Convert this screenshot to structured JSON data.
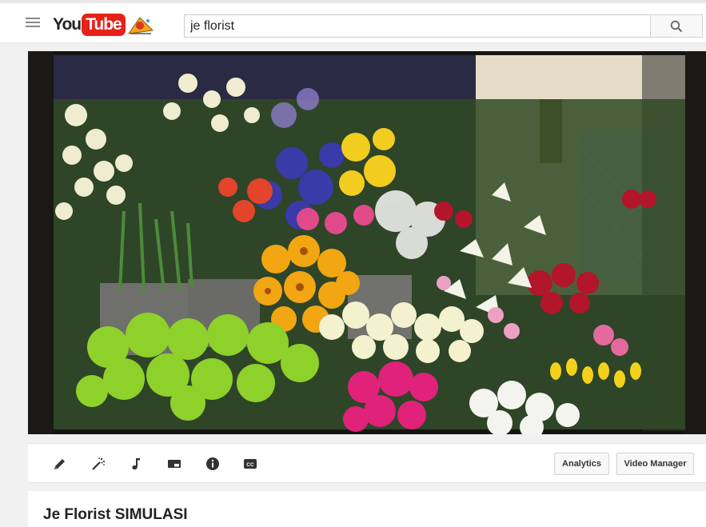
{
  "header": {
    "logo_you": "You",
    "logo_tube": "Tube",
    "search_value": "je florist"
  },
  "editor_tools": [
    {
      "name": "enhancements",
      "icon": "pencil-icon"
    },
    {
      "name": "effects",
      "icon": "magic-wand-icon"
    },
    {
      "name": "audio",
      "icon": "music-note-icon"
    },
    {
      "name": "end-screen",
      "icon": "end-screen-icon"
    },
    {
      "name": "cards",
      "icon": "info-icon"
    },
    {
      "name": "subtitles",
      "icon": "closed-captions-icon"
    }
  ],
  "buttons": {
    "analytics": "Analytics",
    "video_manager": "Video Manager"
  },
  "video": {
    "title": "Je Florist SIMULASI"
  },
  "colors": {
    "brand_red": "#e62117",
    "icon_gray": "#333333"
  }
}
